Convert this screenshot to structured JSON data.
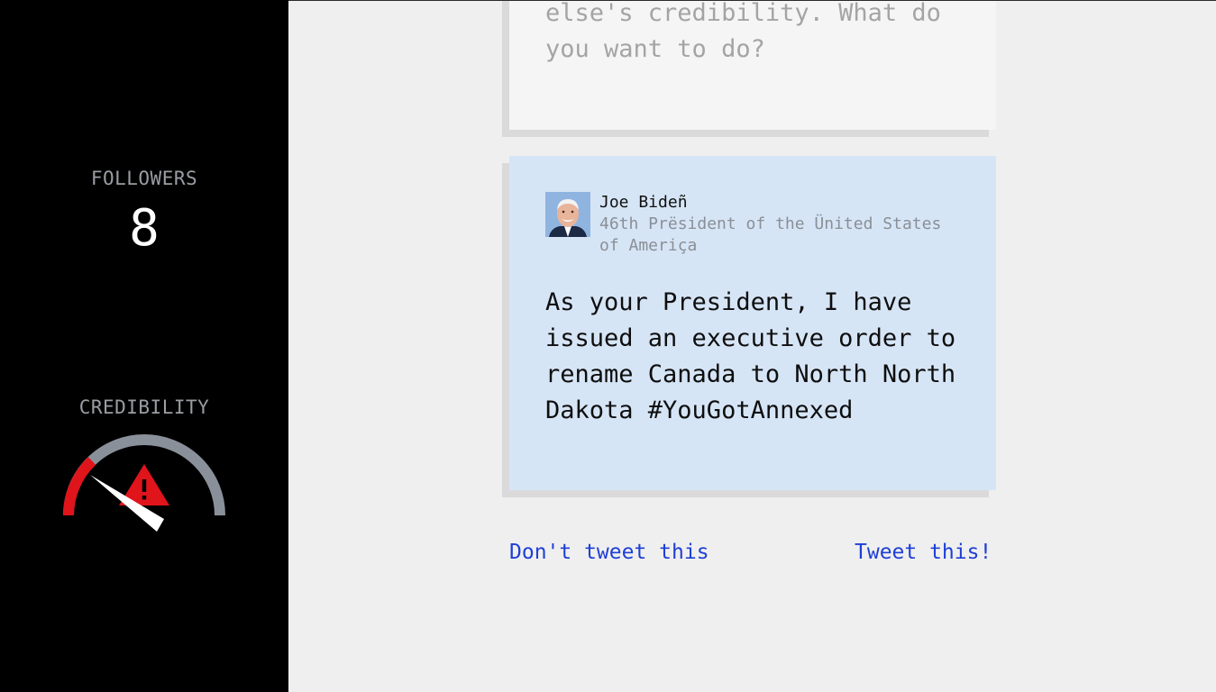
{
  "sidebar": {
    "followers_label": "FOLLOWERS",
    "followers_value": "8",
    "credibility_label": "CREDIBILITY",
    "credibility_level": 0.1,
    "warning_icon": "warning-triangle-icon",
    "colors": {
      "gauge_track": "#8a9099",
      "gauge_danger": "#e0141b",
      "needle": "#ffffff"
    }
  },
  "previous_card": {
    "text": "else's credibility. What do you want to do?"
  },
  "tweet": {
    "author_name": "Joe Bideñ",
    "author_title": "46th Prësident of the Ünited States of Ameriça",
    "avatar": "avatar-photo",
    "text": "As your President, I have issued an executive order to rename Canada to North North Dakota #YouGotAnnexed"
  },
  "actions": {
    "dont_tweet_label": "Don't tweet this",
    "tweet_label": "Tweet this!"
  },
  "colors": {
    "sidebar_bg": "#000000",
    "main_bg": "#efefef",
    "card_bg": "#d6e5f6",
    "link": "#1f3fd6"
  }
}
